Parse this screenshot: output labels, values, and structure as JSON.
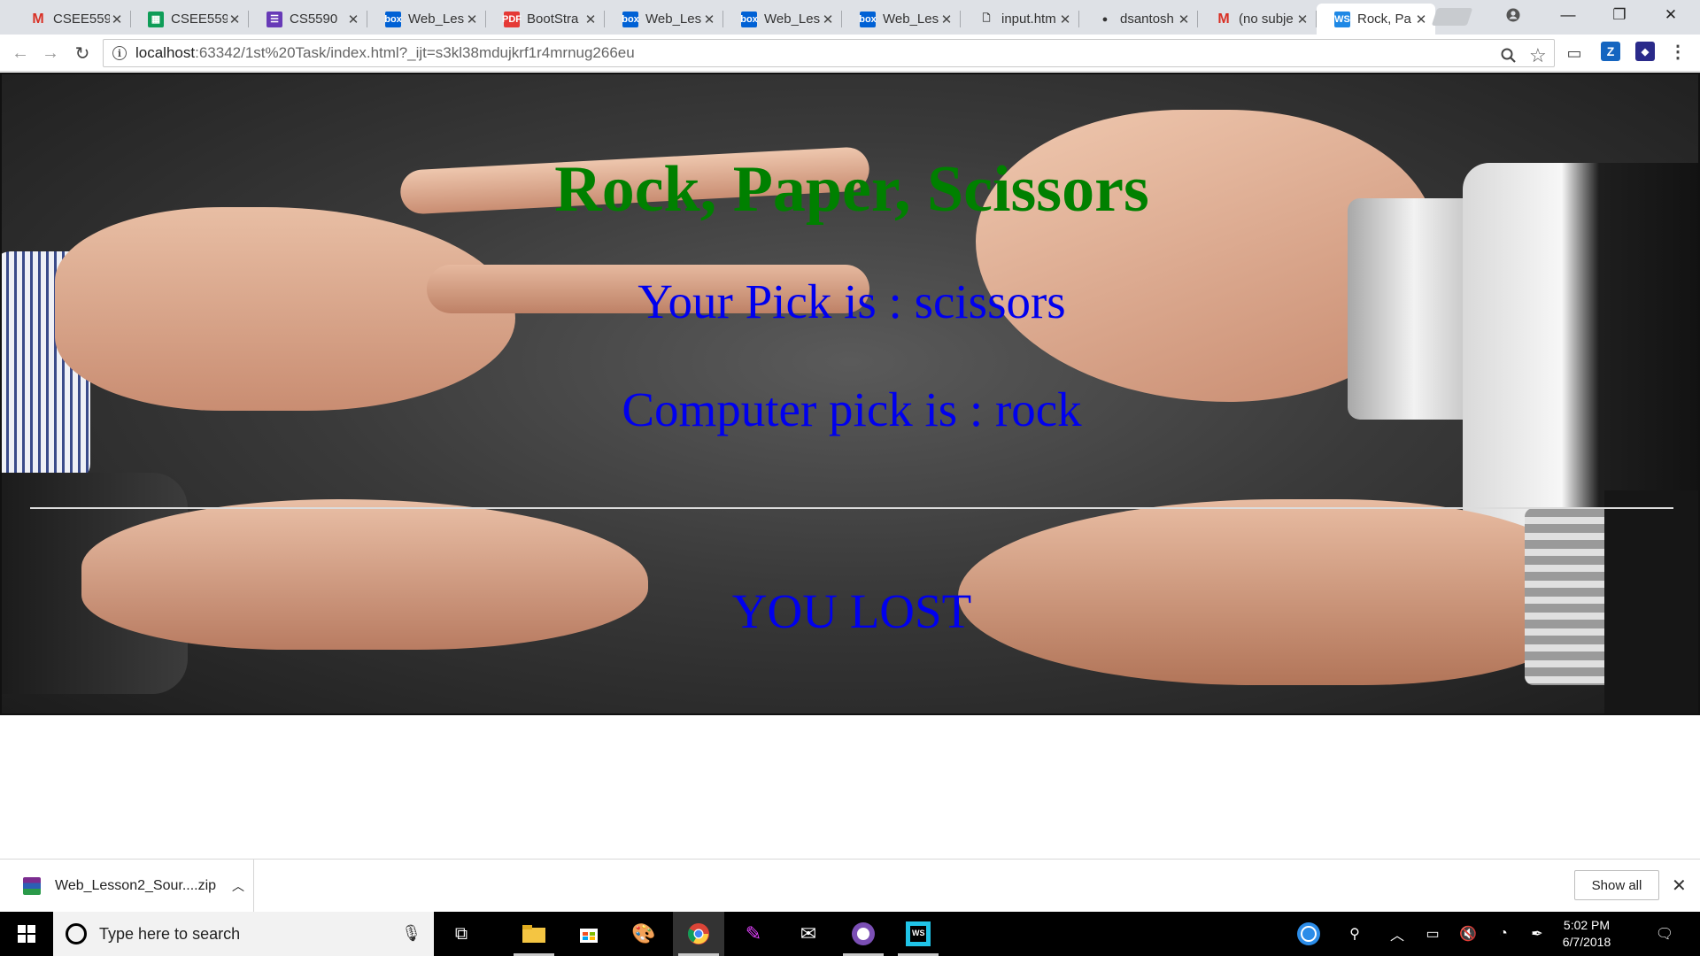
{
  "browser": {
    "tabs": [
      {
        "title": "CSEE559",
        "icon": "gmail-icon",
        "color": "#d93025",
        "glyph": "M"
      },
      {
        "title": "CSEE559",
        "icon": "sheets-icon",
        "color": "#0f9d58",
        "glyph": "▦"
      },
      {
        "title": "CS5590",
        "icon": "forms-icon",
        "color": "#673ab7",
        "glyph": "☰"
      },
      {
        "title": "Web_Les",
        "icon": "box-icon",
        "color": "#0061d5",
        "glyph": "box"
      },
      {
        "title": "BootStra",
        "icon": "pdf-icon",
        "color": "#e53935",
        "glyph": "PDF"
      },
      {
        "title": "Web_Les",
        "icon": "box-icon",
        "color": "#0061d5",
        "glyph": "box"
      },
      {
        "title": "Web_Les",
        "icon": "box-icon",
        "color": "#0061d5",
        "glyph": "box"
      },
      {
        "title": "Web_Les",
        "icon": "box-icon",
        "color": "#0061d5",
        "glyph": "box"
      },
      {
        "title": "input.htm",
        "icon": "file-icon",
        "color": "#ffffff",
        "glyph": "🗋"
      },
      {
        "title": "dsantosh",
        "icon": "github-icon",
        "color": "#ffffff",
        "glyph": "●"
      },
      {
        "title": "(no subje",
        "icon": "gmail-icon",
        "color": "#d93025",
        "glyph": "M"
      },
      {
        "title": "Rock, Pa",
        "icon": "webstorm-icon",
        "color": "#1e88e5",
        "glyph": "WS"
      }
    ],
    "close_glyph": "✕",
    "address": {
      "host": "localhost",
      "path": ":63342/1st%20Task/index.html?_ijt=s3kl38mdujkrf1r4mrnug266eu"
    }
  },
  "game": {
    "title": "Rock, Paper, Scissors",
    "your_pick": "Your Pick is : scissors",
    "computer_pick": "Computer pick is : rock",
    "result": "YOU LOST"
  },
  "downloads": {
    "file_name": "Web_Lesson2_Sour....zip",
    "show_all_label": "Show all"
  },
  "taskbar": {
    "search_placeholder": "Type here to search",
    "time": "5:02 PM",
    "date": "6/7/2018"
  }
}
